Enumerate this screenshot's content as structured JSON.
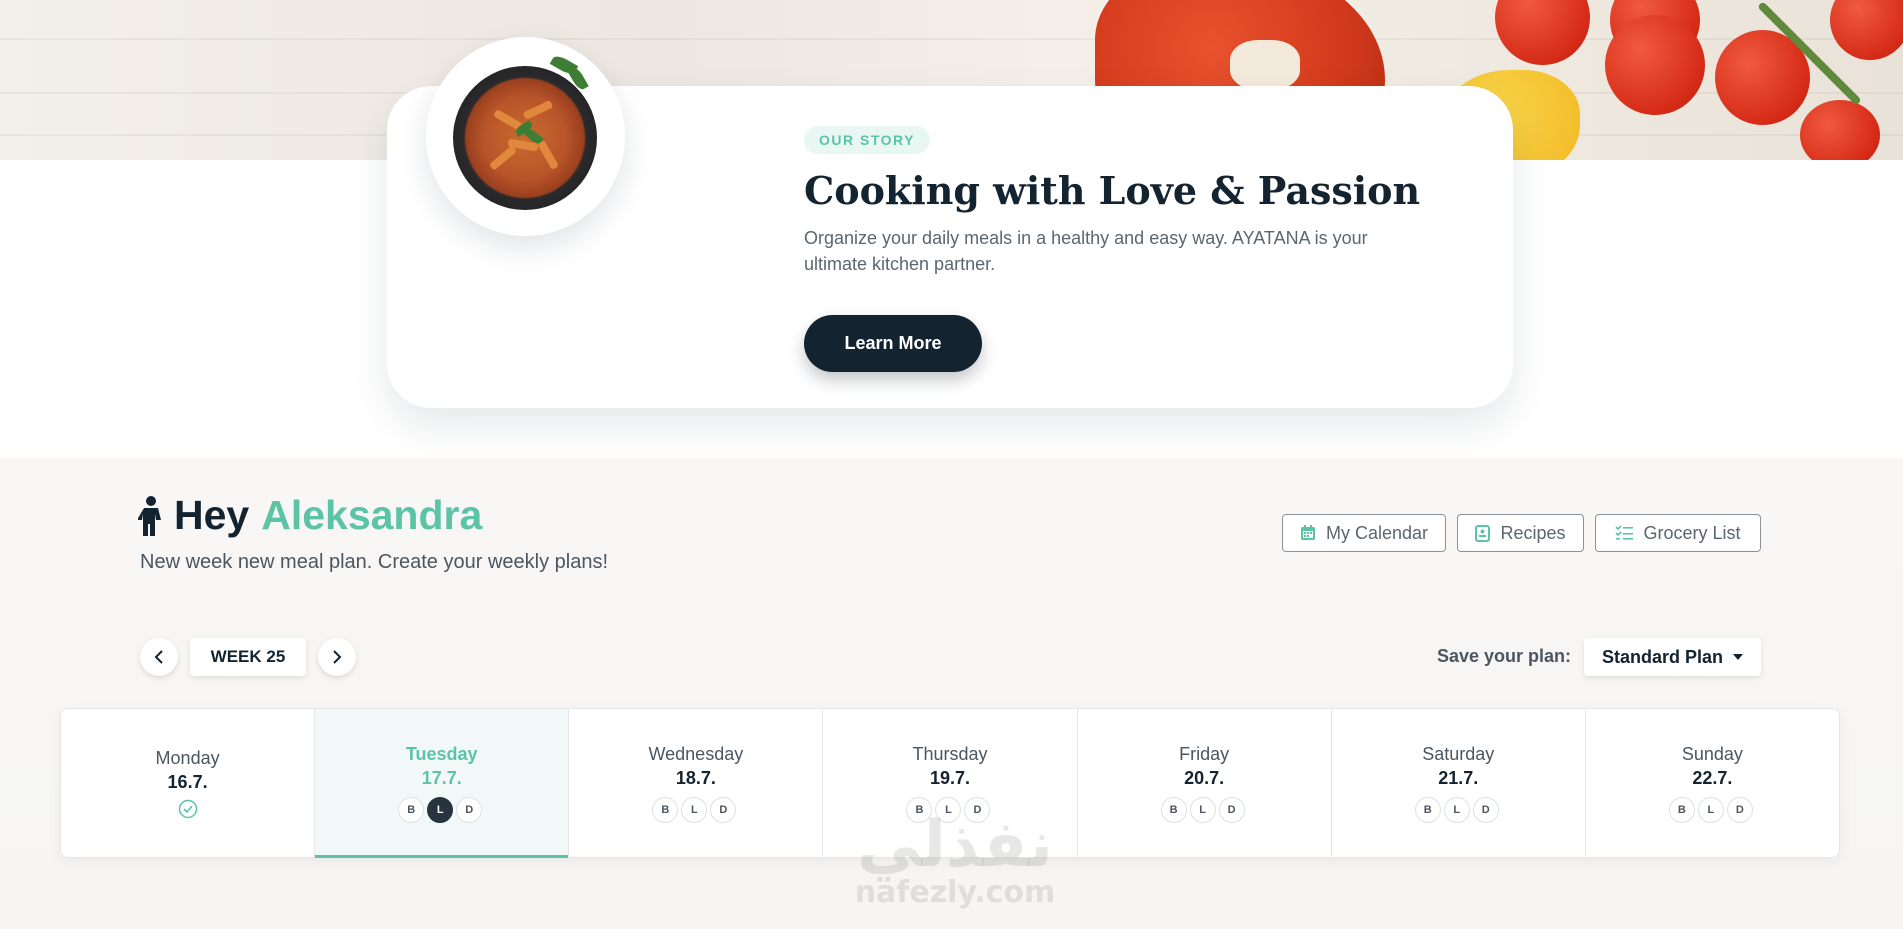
{
  "story": {
    "badge": "OUR STORY",
    "title": "Cooking with Love & Passion",
    "description": "Organize your daily meals in a healthy and easy way. AYATANA is your ultimate kitchen partner.",
    "cta_label": "Learn More"
  },
  "planner": {
    "greeting_hey": "Hey",
    "greeting_name": "Aleksandra",
    "subtitle": "New week new meal plan. Create your weekly plans!",
    "actions": [
      {
        "label": "My Calendar",
        "icon": "calendar-icon"
      },
      {
        "label": "Recipes",
        "icon": "recipes-book-icon"
      },
      {
        "label": "Grocery List",
        "icon": "checklist-icon"
      }
    ],
    "week_label": "WEEK 25",
    "save_label": "Save your plan:",
    "plan_selected": "Standard Plan",
    "days": [
      {
        "name": "Monday",
        "date": "16.7.",
        "completed": true
      },
      {
        "name": "Tuesday",
        "date": "17.7.",
        "active": true
      },
      {
        "name": "Wednesday",
        "date": "18.7."
      },
      {
        "name": "Thursday",
        "date": "19.7."
      },
      {
        "name": "Friday",
        "date": "20.7."
      },
      {
        "name": "Saturday",
        "date": "21.7."
      },
      {
        "name": "Sunday",
        "date": "22.7."
      }
    ],
    "meal_labels": [
      "B",
      "L",
      "D"
    ],
    "selected_meal": "L"
  },
  "watermark": {
    "arabic": "نفذلي",
    "latin": "nafezly.com"
  },
  "colors": {
    "accent": "#5cc4a6",
    "dark": "#132330",
    "muted": "#5b6670"
  }
}
